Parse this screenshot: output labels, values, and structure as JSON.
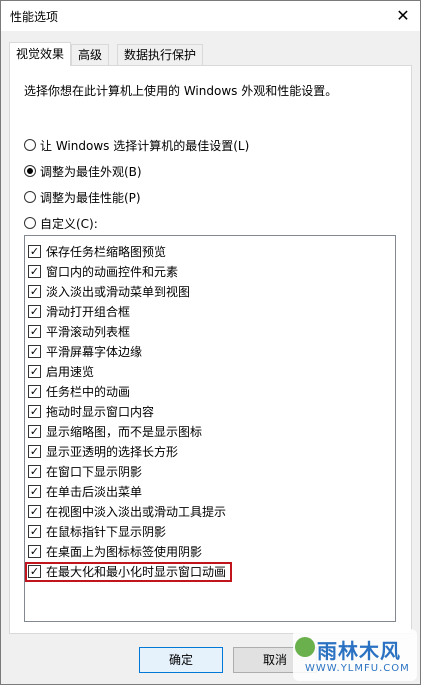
{
  "window": {
    "title": "性能选项",
    "close_glyph": "✕"
  },
  "tabs": [
    {
      "label": "视觉效果",
      "active": true
    },
    {
      "label": "高级",
      "active": false
    },
    {
      "label": "数据执行保护",
      "active": false
    }
  ],
  "description": "选择你想在此计算机上使用的 Windows 外观和性能设置。",
  "radios": [
    {
      "label": "让 Windows 选择计算机的最佳设置(L)",
      "checked": false
    },
    {
      "label": "调整为最佳外观(B)",
      "checked": true
    },
    {
      "label": "调整为最佳性能(P)",
      "checked": false
    },
    {
      "label": "自定义(C):",
      "checked": false
    }
  ],
  "options": [
    {
      "label": "保存任务栏缩略图预览",
      "checked": true
    },
    {
      "label": "窗口内的动画控件和元素",
      "checked": true
    },
    {
      "label": "淡入淡出或滑动菜单到视图",
      "checked": true
    },
    {
      "label": "滑动打开组合框",
      "checked": true
    },
    {
      "label": "平滑滚动列表框",
      "checked": true
    },
    {
      "label": "平滑屏幕字体边缘",
      "checked": true
    },
    {
      "label": "启用速览",
      "checked": true
    },
    {
      "label": "任务栏中的动画",
      "checked": true
    },
    {
      "label": "拖动时显示窗口内容",
      "checked": true
    },
    {
      "label": "显示缩略图，而不是显示图标",
      "checked": true
    },
    {
      "label": "显示亚透明的选择长方形",
      "checked": true
    },
    {
      "label": "在窗口下显示阴影",
      "checked": true
    },
    {
      "label": "在单击后淡出菜单",
      "checked": true
    },
    {
      "label": "在视图中淡入淡出或滑动工具提示",
      "checked": true
    },
    {
      "label": "在鼠标指针下显示阴影",
      "checked": true
    },
    {
      "label": "在桌面上为图标标签使用阴影",
      "checked": true
    },
    {
      "label": "在最大化和最小化时显示窗口动画",
      "checked": true
    }
  ],
  "buttons": {
    "ok": "确定",
    "other": "取消"
  },
  "watermark": {
    "title": "雨林木风",
    "url": "WWW.YLMFU.COM"
  },
  "colors": {
    "highlight_border": "#c0151d",
    "ok_border": "#0078d7",
    "watermark": "#2b73c2"
  }
}
